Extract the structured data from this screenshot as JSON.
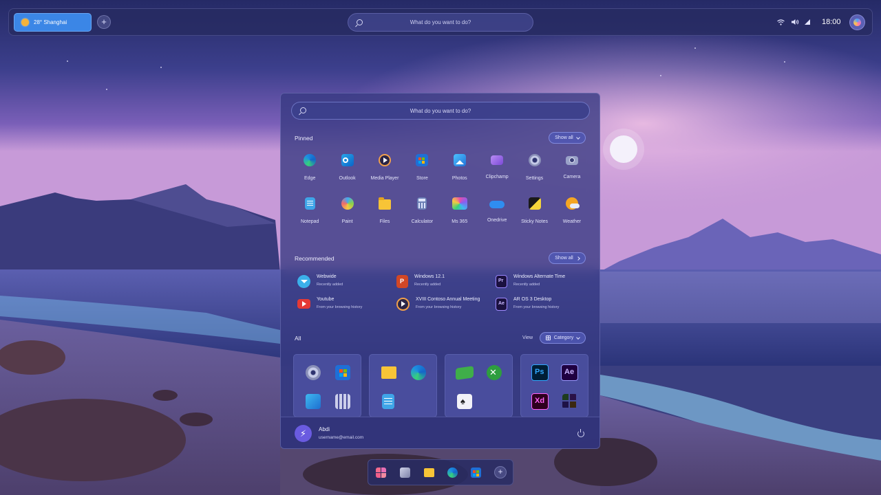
{
  "topbar": {
    "weather": "28° Shanghai",
    "add_widget": "+",
    "search_placeholder": "What do you want to do?",
    "time": "18:00",
    "tray_icons": [
      "wifi-icon",
      "volume-icon",
      "battery-icon"
    ]
  },
  "start": {
    "search_placeholder": "What do you want to do?",
    "pinned_title": "Pinned",
    "show_all": "Show all",
    "pinned": [
      {
        "label": "Edge",
        "icon": "edge-icon"
      },
      {
        "label": "Outlook",
        "icon": "outlook-icon"
      },
      {
        "label": "Media Player",
        "icon": "media-player-icon"
      },
      {
        "label": "Store",
        "icon": "store-icon"
      },
      {
        "label": "Photos",
        "icon": "photos-icon"
      },
      {
        "label": "Clipchamp",
        "icon": "clipchamp-icon"
      },
      {
        "label": "Settings",
        "icon": "settings-icon"
      },
      {
        "label": "Camera",
        "icon": "camera-icon"
      },
      {
        "label": "Notepad",
        "icon": "notepad-icon"
      },
      {
        "label": "Paint",
        "icon": "paint-icon"
      },
      {
        "label": "Files",
        "icon": "files-icon"
      },
      {
        "label": "Calculator",
        "icon": "calculator-icon"
      },
      {
        "label": "Ms 365",
        "icon": "ms365-icon"
      },
      {
        "label": "Onedrive",
        "icon": "onedrive-icon"
      },
      {
        "label": "Sticky Notes",
        "icon": "sticky-notes-icon"
      },
      {
        "label": "Weather",
        "icon": "weather-icon"
      }
    ],
    "recommended_title": "Recommended",
    "recommended_show_all": "Show all",
    "recommended": [
      {
        "name": "Webwide",
        "sub": "Recently added",
        "icon": "webwide-icon"
      },
      {
        "name": "Windows 12.1",
        "sub": "Recently added",
        "icon": "powerpoint-icon"
      },
      {
        "name": "Windows Alternate Time",
        "sub": "Recently added",
        "icon": "premiere-icon"
      },
      {
        "name": "Youtube",
        "sub": "From your browsing history",
        "icon": "youtube-icon"
      },
      {
        "name": "XVIII Contoso Annual Meeting",
        "sub": "From your browsing history",
        "icon": "media-player-icon"
      },
      {
        "name": "AR OS 3 Desktop",
        "sub": "From your browsing history",
        "icon": "after-effects-icon"
      }
    ],
    "all_title": "All",
    "view_label": "View",
    "category_label": "Category",
    "ps_label": "Ps",
    "ae_label": "Ae",
    "xd_label": "Xd",
    "user": {
      "name": "Abdi",
      "email": "username@email.com"
    }
  },
  "taskbar": {
    "icons": [
      "windows-start-icon",
      "task-view-icon",
      "file-explorer-icon",
      "edge-icon",
      "store-icon",
      "add-icon"
    ]
  },
  "colors": {
    "accent": "#3b86e6",
    "panel": "#37398a"
  }
}
